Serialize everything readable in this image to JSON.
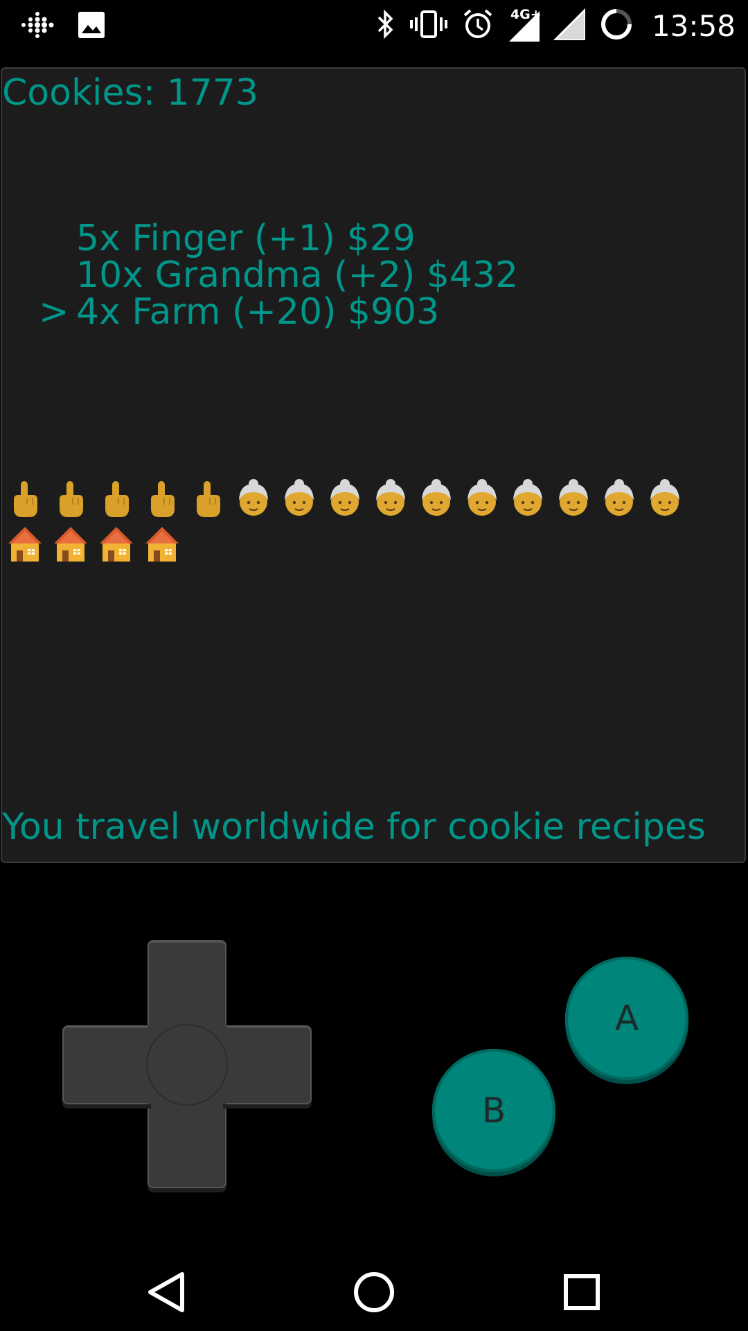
{
  "status_bar": {
    "time": "13:58",
    "network_label": "4G+",
    "icons": [
      "fitbit-icon",
      "image-icon",
      "bluetooth-icon",
      "vibrate-icon",
      "alarm-icon",
      "signal-4g-icon",
      "signal-icon",
      "battery-icon"
    ]
  },
  "game": {
    "cookie_label": "Cookies:",
    "cookie_count": "1773",
    "shop": [
      {
        "cursor": "",
        "count": "5x",
        "name": "Finger",
        "bonus": "(+1)",
        "price": "$29"
      },
      {
        "cursor": "",
        "count": "10x",
        "name": "Grandma",
        "bonus": "(+2)",
        "price": "$432"
      },
      {
        "cursor": ">",
        "count": "4x",
        "name": "Farm",
        "bonus": "(+20)",
        "price": "$903"
      }
    ],
    "owned": {
      "finger": 5,
      "grandma": 10,
      "farm": 4
    },
    "flavor_text": "You travel worldwide for cookie recipes"
  },
  "controls": {
    "a_label": "A",
    "b_label": "B"
  },
  "colors": {
    "text": "#00968a",
    "screen_bg": "#1c1c1c",
    "button": "#00857a",
    "dpad": "#3a3a3a"
  }
}
